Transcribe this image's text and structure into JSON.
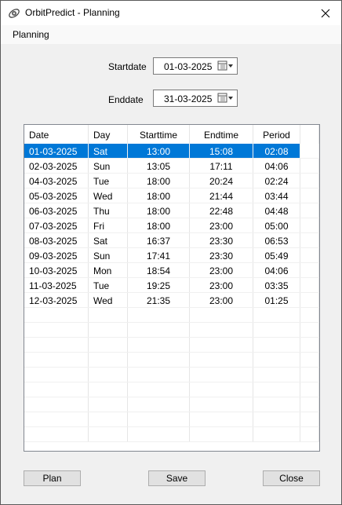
{
  "window": {
    "title": "OrbitPredict - Planning"
  },
  "menu": {
    "items": [
      "Planning"
    ]
  },
  "form": {
    "start_label": "Startdate",
    "start_value": "01-03-2025",
    "end_label": "Enddate",
    "end_value": "31-03-2025"
  },
  "table": {
    "columns": [
      "Date",
      "Day",
      "Starttime",
      "Endtime",
      "Period"
    ],
    "rows": [
      [
        "01-03-2025",
        "Sat",
        "13:00",
        "15:08",
        "02:08"
      ],
      [
        "02-03-2025",
        "Sun",
        "13:05",
        "17:11",
        "04:06"
      ],
      [
        "04-03-2025",
        "Tue",
        "18:00",
        "20:24",
        "02:24"
      ],
      [
        "05-03-2025",
        "Wed",
        "18:00",
        "21:44",
        "03:44"
      ],
      [
        "06-03-2025",
        "Thu",
        "18:00",
        "22:48",
        "04:48"
      ],
      [
        "07-03-2025",
        "Fri",
        "18:00",
        "23:00",
        "05:00"
      ],
      [
        "08-03-2025",
        "Sat",
        "16:37",
        "23:30",
        "06:53"
      ],
      [
        "09-03-2025",
        "Sun",
        "17:41",
        "23:30",
        "05:49"
      ],
      [
        "10-03-2025",
        "Mon",
        "18:54",
        "23:00",
        "04:06"
      ],
      [
        "11-03-2025",
        "Tue",
        "19:25",
        "23:00",
        "03:35"
      ],
      [
        "12-03-2025",
        "Wed",
        "21:35",
        "23:00",
        "01:25"
      ]
    ],
    "selected_row": 0
  },
  "buttons": {
    "plan": "Plan",
    "save": "Save",
    "close": "Close"
  },
  "colors": {
    "selection": "#0078d7"
  }
}
